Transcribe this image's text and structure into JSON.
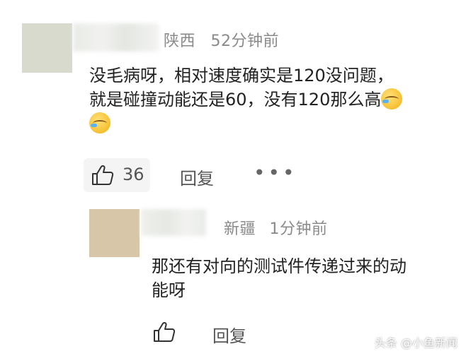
{
  "comment1": {
    "location": "陕西",
    "time": "52分钟前",
    "text_line1": "没毛病呀，相对速度确实是120没问题，",
    "text_line2": "就是碰撞动能还是60，没有120那么高",
    "emoji_icon": "cry-laugh-emoji",
    "like_count": "36",
    "reply_label": "回复",
    "more_label": "•••"
  },
  "comment2": {
    "location": "新疆",
    "time": "1分钟前",
    "text_line1": "那还有对向的测试件传递过来的动",
    "text_line2": "能呀",
    "reply_label": "回复"
  },
  "watermark": "头条 @小鱼新闻"
}
